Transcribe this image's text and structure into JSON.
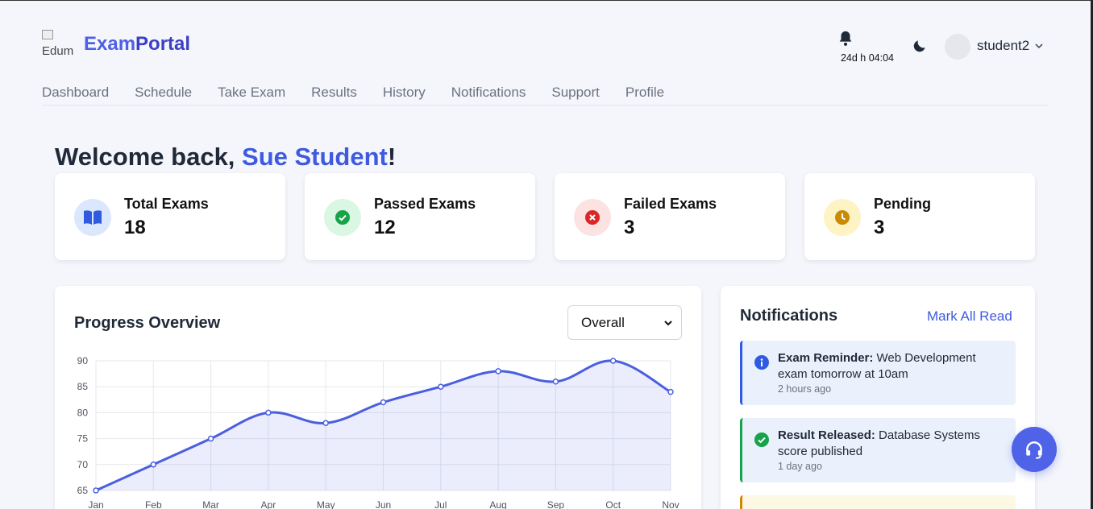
{
  "header": {
    "logo_alt": "Edum",
    "brand_part1": "Exam",
    "brand_part2": "Portal",
    "timer": "24d h 04:04",
    "username": "student2"
  },
  "nav": [
    "Dashboard",
    "Schedule",
    "Take Exam",
    "Results",
    "History",
    "Notifications",
    "Support",
    "Profile"
  ],
  "welcome": {
    "prefix": "Welcome back, ",
    "name": "Sue Student",
    "suffix": "!"
  },
  "stats": [
    {
      "label": "Total Exams",
      "value": "18",
      "icon": "book-icon",
      "bg": "#dbe7fd",
      "color": "#2f5be0"
    },
    {
      "label": "Passed Exams",
      "value": "12",
      "icon": "check-circle-icon",
      "bg": "#d9f7e3",
      "color": "#16a34a"
    },
    {
      "label": "Failed Exams",
      "value": "3",
      "icon": "x-circle-icon",
      "bg": "#fde2e2",
      "color": "#dc2626"
    },
    {
      "label": "Pending",
      "value": "3",
      "icon": "clock-icon",
      "bg": "#fdf3c4",
      "color": "#ca8a04"
    }
  ],
  "progress": {
    "title": "Progress Overview",
    "filter": "Overall"
  },
  "chart_data": {
    "type": "area",
    "categories": [
      "Jan",
      "Feb",
      "Mar",
      "Apr",
      "May",
      "Jun",
      "Jul",
      "Aug",
      "Sep",
      "Oct",
      "Nov"
    ],
    "values": [
      65,
      70,
      75,
      80,
      78,
      82,
      85,
      88,
      86,
      90,
      84
    ],
    "yticks": [
      65,
      70,
      75,
      80,
      85,
      90
    ],
    "ylim": [
      65,
      90
    ],
    "grid": true,
    "color": "#4a5fe0"
  },
  "notifications": {
    "title": "Notifications",
    "mark_all": "Mark All Read",
    "items": [
      {
        "title": "Exam Reminder:",
        "text": " Web Development exam tomorrow at 10am",
        "time": "2 hours ago",
        "icon": "info-icon",
        "accent": "#2f5be0",
        "bg": "#eaf1fd"
      },
      {
        "title": "Result Released:",
        "text": " Database Systems score published",
        "time": "1 day ago",
        "icon": "check-circle-icon",
        "accent": "#16a34a",
        "bg": "#eaf1fd"
      }
    ]
  },
  "support": {
    "icon": "headset-icon"
  }
}
